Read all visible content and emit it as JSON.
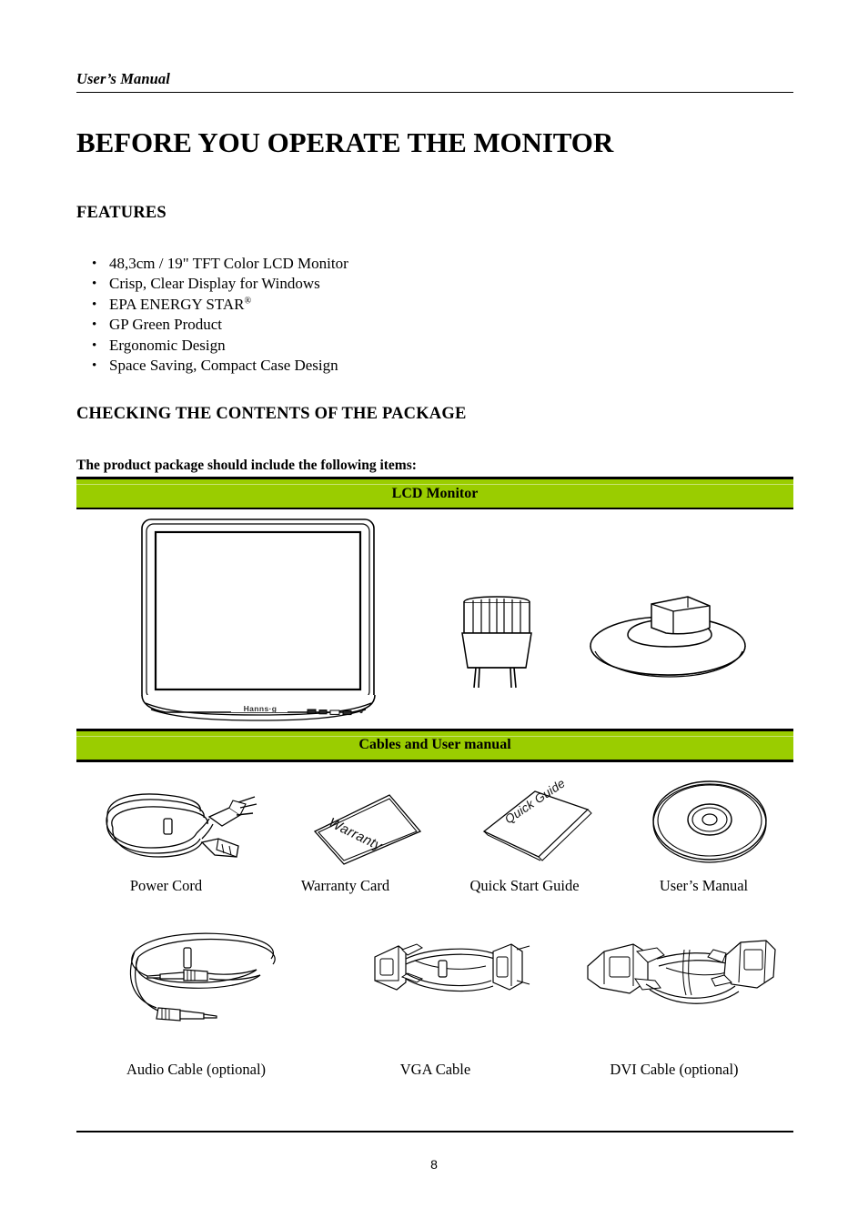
{
  "document": {
    "running_header": "User’s Manual",
    "chapter_title": "BEFORE YOU OPERATE THE MONITOR",
    "page_number": "8"
  },
  "features_section": {
    "heading": "FEATURES",
    "bullet_glyph": "•",
    "items": [
      {
        "text": "48,3cm / 19\" TFT Color LCD Monitor",
        "superscript": ""
      },
      {
        "text": "Crisp, Clear Display for Windows",
        "superscript": ""
      },
      {
        "text": "EPA ENERGY STAR",
        "superscript": "®"
      },
      {
        "text": "GP Green Product",
        "superscript": ""
      },
      {
        "text": "Ergonomic Design",
        "superscript": ""
      },
      {
        "text": "Space Saving, Compact Case Design",
        "superscript": ""
      }
    ]
  },
  "package_section": {
    "heading": "CHECKING THE CONTENTS OF THE PACKAGE",
    "lead_text": "The product package should include the following items:",
    "band_monitor_label": "LCD Monitor",
    "band_cables_label": "Cables and User manual",
    "band_color": "#9acd00",
    "monitor_brand_label": "Hanns·g",
    "accessory_row_1": [
      {
        "caption": "Power Cord",
        "icon": "power-cord-icon"
      },
      {
        "caption": "Warranty Card",
        "icon": "warranty-card-icon",
        "art_label": "Warranty"
      },
      {
        "caption": "Quick Start Guide",
        "icon": "quick-guide-booklet-icon",
        "art_label": "Quick Guide"
      },
      {
        "caption": "User’s Manual",
        "icon": "cd-disc-icon"
      }
    ],
    "accessory_row_2": [
      {
        "caption": "Audio Cable (optional)",
        "icon": "audio-cable-icon"
      },
      {
        "caption": "VGA Cable",
        "icon": "vga-cable-icon"
      },
      {
        "caption": "DVI Cable (optional)",
        "icon": "dvi-cable-icon"
      }
    ]
  }
}
